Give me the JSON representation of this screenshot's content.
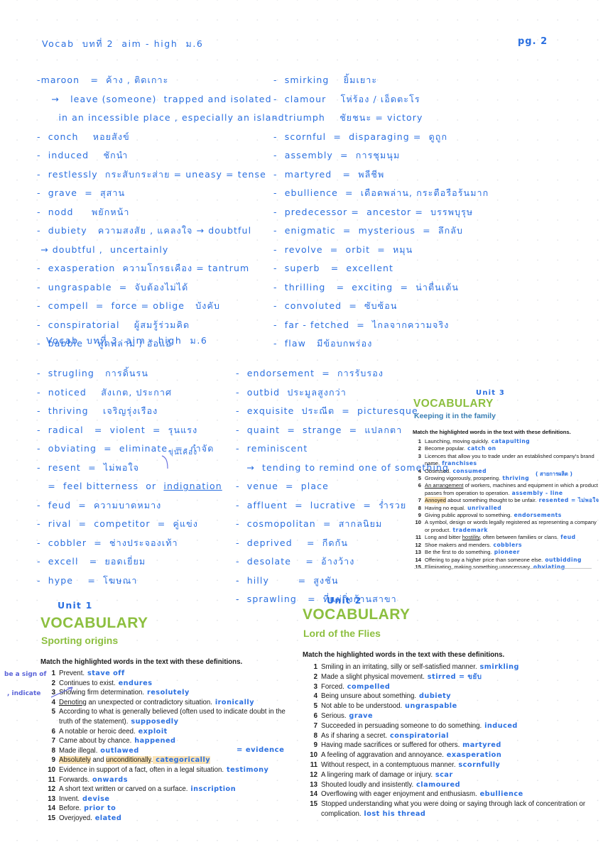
{
  "page": {
    "page_marker": "pg. 2",
    "ink_color": "#2a6fe0",
    "heading_green": "#8cbf3f",
    "highlight_color": "#fbe3b4"
  },
  "notes_section_1": {
    "heading": "Vocab  บทที่ 2  aim - high  ม.6",
    "left_column": [
      "-maroon   =  ค้าง , ติดเกาะ",
      "    →   leave (someone)  trapped and isolated",
      "      in an incessible place , especially an island",
      "-  conch    หอยสังข์",
      "-  induced    ชักนำ",
      "-  restlessly  กระสับกระส่าย = uneasy = tense",
      "-  grave  =  สุสาน",
      "-  nodd     พยักหน้า",
      "-  dubiety   ความสงสัย , แคลงใจ → doubtful",
      " → doubtful ,  uncertainly",
      "-  exasperation  ความโกรธเคือง = tantrum",
      "-  ungraspable  =  จับต้องไม่ได้",
      "-  compell  =  force = oblige   บังคับ",
      "-  conspiratorial    ผู้สมรู้ร่วมคิด",
      "-  babble    พูดพล่าม / อ้อแอ้"
    ],
    "right_column": [
      "-  smirking    ยิ้มเยาะ",
      "-  clamour    โห่ร้อง / เอ็ดตะโร",
      "-  triumph    ชัยชนะ = victory",
      "-  scornful  =  disparaging =  ดูถูก",
      "-  assembly  =  การชุมนุม",
      "-  martyred   =  พลีชีพ",
      "-  ebullience  =  เดือดพล่าน, กระตือรือร้นมาก",
      "-  predecessor =  ancestor =  บรรพบุรุษ",
      "-  enigmatic  =  mysterious  =  ลึกลับ",
      "-  revolve  =  orbit  =  หมุน",
      "-  superb   =  excellent",
      "-  thrilling   =  exciting  =  น่าตื่นเต้น",
      "-  convoluted  =  ซับซ้อน",
      "-  far - fetched  =  ไกลจากความจริง",
      "-  flaw   มีข้อบกพร่อง"
    ]
  },
  "notes_section_2": {
    "heading": "Vocab  บทที่ 3  aim - high  ม.6",
    "left_column": [
      "-  strugling   การดิ้นรน",
      "-  noticed    สังเกต, ประกาศ",
      "-  thriving    เจริญรุ่งเรือง",
      "-  radical   =  violent  =  รุนแรง",
      "-  obviating  =  eliminate  =  กำจัด",
      "-  resent  =  ไม่พอใจ",
      "   =  feel bitterness  or  indignation",
      "-  feud  =  ความบาดหมาง",
      "-  rival  =  competitor  =  คู่แข่ง",
      "-  cobbler  =  ช่างประจองเท้า",
      "-  excell   =  ยอดเยี่ยม",
      "-  hype    =  โฆษณา"
    ],
    "right_column": [
      "-  endorsement  =  การรับรอง",
      "-  outbid  ประมูลสูงกว่า",
      "-  exquisite  ประณีต  =  picturesque",
      "-  quaint  =  strange  =  แปลกตา",
      "-  reminiscent",
      "   →  tending to remind one of something",
      "-  venue  =  place",
      "-  affluent  =  lucrative  =  ร่ำรวย",
      "-  cosmopolitan  =  สากลนิยม",
      "-  deprived    =  กีดกัน",
      "-  desolate    =  อ้างว้าง",
      "-  hilly        =  สูงชัน",
      "-  sprawling   =  ที่แผ่กิ่งก้านสาขา"
    ],
    "annotation_indignation": "ขุ่นเคือง"
  },
  "unit3_panel": {
    "unit_tag": "Unit 3",
    "title": "VOCABULARY",
    "subtitle": "Keeping it in the family",
    "instruction": "Match the highlighted words in the text with these definitions.",
    "side_note": "( สายการผลิต )",
    "items": [
      {
        "n": "1",
        "text": "Launching, moving quickly.",
        "answer": "catapulting"
      },
      {
        "n": "2",
        "text": "Become popular.",
        "answer": "catch on"
      },
      {
        "n": "3",
        "text": "Licences that allow you to trade under an established company's brand name.",
        "answer": "franchises"
      },
      {
        "n": "4",
        "text": "Obsessed.",
        "answer": "consumed"
      },
      {
        "n": "5",
        "text": "Growing vigorously, prospering.",
        "answer": "thriving"
      },
      {
        "n": "6",
        "text": "An arrangement of workers, machines and equipment in which a product passes from operation to operation.",
        "answer": "assembly - line"
      },
      {
        "n": "7",
        "text": "Annoyed about something thought to be unfair.",
        "answer": "resented = ไม่พอใจ"
      },
      {
        "n": "8",
        "text": "Having no equal.",
        "answer": "unrivalled"
      },
      {
        "n": "9",
        "text": "Giving public approval to something.",
        "answer": "endorsements"
      },
      {
        "n": "10",
        "text": "A symbol, design or words legally registered as representing a company or product.",
        "answer": "trademark"
      },
      {
        "n": "11",
        "text": "Long and bitter hostility, often between families or clans.",
        "answer": "feud"
      },
      {
        "n": "12",
        "text": "Shoe makers and menders.",
        "answer": "cobblers"
      },
      {
        "n": "13",
        "text": "Be the first to do something.",
        "answer": "pioneer"
      },
      {
        "n": "14",
        "text": "Offering to pay a higher price than someone else.",
        "answer": "outbidding"
      },
      {
        "n": "15",
        "text": "Eliminating, making something unnecessary.",
        "answer": "obviating"
      }
    ]
  },
  "unit1_panel": {
    "unit_tag": "Unit 1",
    "title": "VOCABULARY",
    "subtitle": "Sporting origins",
    "instruction": "Match the highlighted words in the text with these definitions.",
    "margin_note_1": "be a sign of",
    "margin_note_2": ", indicate",
    "side_note": "= evidence",
    "items": [
      {
        "n": "1",
        "text": "Prevent.",
        "answer": "stave off"
      },
      {
        "n": "2",
        "text": "Continues to exist.",
        "answer": "endures"
      },
      {
        "n": "3",
        "text": "Showing firm determination.",
        "answer": "resolutely"
      },
      {
        "n": "4",
        "text": "Denoting an unexpected or contradictory situation.",
        "answer": "ironically"
      },
      {
        "n": "5",
        "text": "According to what is generally believed (often used to indicate doubt in the truth of the statement).",
        "answer": "supposedly"
      },
      {
        "n": "6",
        "text": "A notable or heroic deed.",
        "answer": "exploit"
      },
      {
        "n": "7",
        "text": "Came about by chance.",
        "answer": "happened"
      },
      {
        "n": "8",
        "text": "Made illegal.",
        "answer": "outlawed"
      },
      {
        "n": "9",
        "text": "Absolutely and unconditionally.",
        "answer": "categorically"
      },
      {
        "n": "10",
        "text": "Evidence in support of a fact, often in a legal situation.",
        "answer": "testimony"
      },
      {
        "n": "11",
        "text": "Forwards.",
        "answer": "onwards"
      },
      {
        "n": "12",
        "text": "A short text written or carved on a surface.",
        "answer": "inscription"
      },
      {
        "n": "13",
        "text": "Invent.",
        "answer": "devise"
      },
      {
        "n": "14",
        "text": "Before.",
        "answer": "prior to"
      },
      {
        "n": "15",
        "text": "Overjoyed.",
        "answer": "elated"
      }
    ]
  },
  "unit2_panel": {
    "unit_tag": "Unit 2",
    "title": "VOCABULARY",
    "subtitle": "Lord of the Flies",
    "instruction": "Match the highlighted words in the text with these definitions.",
    "items": [
      {
        "n": "1",
        "text": "Smiling in an irritating, silly or self-satisfied manner.",
        "answer": "smirkling"
      },
      {
        "n": "2",
        "text": "Made a slight physical movement.",
        "answer": "stirred = ขยับ"
      },
      {
        "n": "3",
        "text": "Forced.",
        "answer": "compelled"
      },
      {
        "n": "4",
        "text": "Being unsure about something.",
        "answer": "dubiety"
      },
      {
        "n": "5",
        "text": "Not able to be understood.",
        "answer": "ungraspable"
      },
      {
        "n": "6",
        "text": "Serious.",
        "answer": "grave"
      },
      {
        "n": "7",
        "text": "Succeeded in persuading someone to do something.",
        "answer": "induced"
      },
      {
        "n": "8",
        "text": "As if sharing a secret.",
        "answer": "conspiratorial"
      },
      {
        "n": "9",
        "text": "Having made sacrifices or suffered for others.",
        "answer": "martyred"
      },
      {
        "n": "10",
        "text": "A feeling of aggravation and annoyance.",
        "answer": "exasperation"
      },
      {
        "n": "11",
        "text": "Without respect, in a contemptuous manner.",
        "answer": "scornfully"
      },
      {
        "n": "12",
        "text": "A lingering mark of damage or injury.",
        "answer": "scar"
      },
      {
        "n": "13",
        "text": "Shouted loudly and insistently.",
        "answer": "clamoured"
      },
      {
        "n": "14",
        "text": "Overflowing with eager enjoyment and enthusiasm.",
        "answer": "ebullience"
      },
      {
        "n": "15",
        "text": "Stopped understanding what you were doing or saying through lack of concentration or complication.",
        "answer": "lost his thread"
      }
    ]
  }
}
